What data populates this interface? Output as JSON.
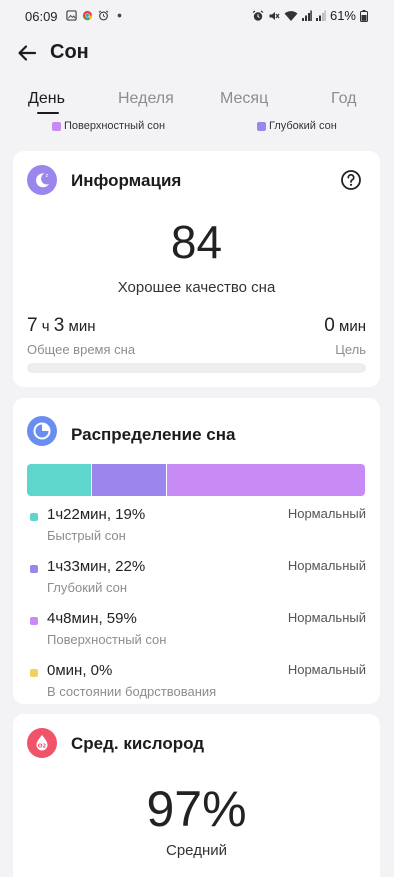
{
  "status_bar": {
    "time": "06:09",
    "battery": "61%",
    "icons": [
      "gallery-icon",
      "chrome-icon",
      "alarm-icon",
      "dot-icon"
    ],
    "right_icons": [
      "alarm-icon",
      "mute-icon",
      "wifi-icon",
      "signal-icon",
      "signal-icon",
      "battery-icon"
    ]
  },
  "header": {
    "title": "Сон"
  },
  "tabs": [
    {
      "label": "День",
      "active": true
    },
    {
      "label": "Неделя",
      "active": false
    },
    {
      "label": "Месяц",
      "active": false
    },
    {
      "label": "Год",
      "active": false
    }
  ],
  "legend": [
    {
      "label": "Поверхностный сон",
      "color": "#c88af5"
    },
    {
      "label": "Глубокий сон",
      "color": "#9b86ee"
    }
  ],
  "info_card": {
    "title": "Информация",
    "score": "84",
    "quality": "Хорошее качество сна",
    "total_h": "7",
    "unit_h": "ч",
    "total_m": "3",
    "unit_m": "мин",
    "total_label": "Общее время сна",
    "goal_value": "0",
    "goal_unit": "мин",
    "goal_label": "Цель",
    "progress": 0
  },
  "distribution_card": {
    "title": "Распределение сна",
    "stages": [
      {
        "value": "1ч22мин, 19%",
        "name": "Быстрый сон",
        "status": "Нормальный",
        "color": "#5fd6cc",
        "percent": 19
      },
      {
        "value": "1ч33мин, 22%",
        "name": "Глубокий сон",
        "status": "Нормальный",
        "color": "#9b86ee",
        "percent": 22
      },
      {
        "value": "4ч8мин, 59%",
        "name": "Поверхностный сон",
        "status": "Нормальный",
        "color": "#c88af5",
        "percent": 59
      },
      {
        "value": "0мин, 0%",
        "name": "В состоянии бодрствования",
        "status": "Нормальный",
        "color": "#f3cf5c",
        "percent": 0
      }
    ]
  },
  "oxygen_card": {
    "title": "Сред. кислород",
    "value": "97%",
    "label": "Средний",
    "icon_text": "O2"
  },
  "colors": {
    "accent_purple": "#9b86ee",
    "accent_blue": "#6a8ef0",
    "oxygen_red": "#f0546a"
  }
}
